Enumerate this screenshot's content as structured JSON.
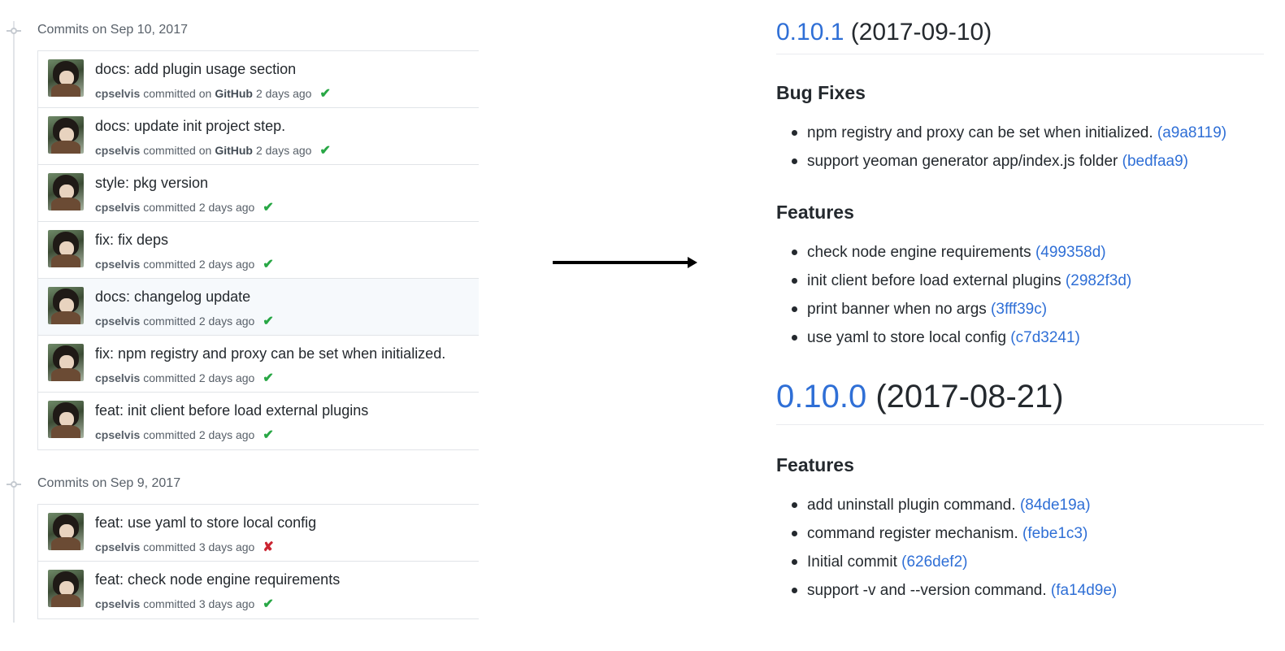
{
  "commits": {
    "groups": [
      {
        "title": "Commits on Sep 10, 2017",
        "items": [
          {
            "message": "docs: add plugin usage section",
            "author": "cpselvis",
            "action": "committed on",
            "via": "GitHub",
            "time": "2 days ago",
            "status": "✔"
          },
          {
            "message": "docs: update init project step.",
            "author": "cpselvis",
            "action": "committed on",
            "via": "GitHub",
            "time": "2 days ago",
            "status": "✔"
          },
          {
            "message": "style: pkg version",
            "author": "cpselvis",
            "action": "committed",
            "via": "",
            "time": "2 days ago",
            "status": "✔"
          },
          {
            "message": "fix: fix deps",
            "author": "cpselvis",
            "action": "committed",
            "via": "",
            "time": "2 days ago",
            "status": "✔"
          },
          {
            "message": "docs: changelog update",
            "author": "cpselvis",
            "action": "committed",
            "via": "",
            "time": "2 days ago",
            "status": "✔"
          },
          {
            "message": "fix: npm registry and proxy can be set when initialized.",
            "author": "cpselvis",
            "action": "committed",
            "via": "",
            "time": "2 days ago",
            "status": "✔"
          },
          {
            "message": "feat: init client before load external plugins",
            "author": "cpselvis",
            "action": "committed",
            "via": "",
            "time": "2 days ago",
            "status": "✔"
          }
        ]
      },
      {
        "title": "Commits on Sep 9, 2017",
        "items": [
          {
            "message": "feat: use yaml to store local config",
            "author": "cpselvis",
            "action": "committed",
            "via": "",
            "time": "3 days ago",
            "status": "✘"
          },
          {
            "message": "feat: check node engine requirements",
            "author": "cpselvis",
            "action": "committed",
            "via": "",
            "time": "3 days ago",
            "status": "✔"
          }
        ]
      }
    ]
  },
  "changelog": {
    "releases": [
      {
        "version": "0.10.1",
        "date": " (2017-09-10)",
        "sections": [
          {
            "title": "Bug Fixes",
            "entries": [
              {
                "text": "npm registry and proxy can be set when initialized. ",
                "hash": "(a9a8119)"
              },
              {
                "text": "support yeoman generator app/index.js folder ",
                "hash": "(bedfaa9)"
              }
            ]
          },
          {
            "title": "Features",
            "entries": [
              {
                "text": "check node engine requirements ",
                "hash": "(499358d)"
              },
              {
                "text": "init client before load external plugins ",
                "hash": "(2982f3d)"
              },
              {
                "text": "print banner when no args ",
                "hash": "(3fff39c)"
              },
              {
                "text": "use yaml to store local config ",
                "hash": "(c7d3241)"
              }
            ]
          }
        ]
      },
      {
        "version": "0.10.0",
        "date": " (2017-08-21)",
        "sections": [
          {
            "title": "Features",
            "entries": [
              {
                "text": "add uninstall plugin command. ",
                "hash": "(84de19a)"
              },
              {
                "text": "command register mechanism. ",
                "hash": "(febe1c3)"
              },
              {
                "text": "Initial commit ",
                "hash": "(626def2)"
              },
              {
                "text": "support -v and --version command. ",
                "hash": "(fa14d9e)"
              }
            ]
          }
        ]
      }
    ]
  },
  "colors": {
    "link": "#2f6fd6",
    "success": "#28a745",
    "failure": "#cb2431",
    "highlight_row": "#f6f9fc"
  }
}
